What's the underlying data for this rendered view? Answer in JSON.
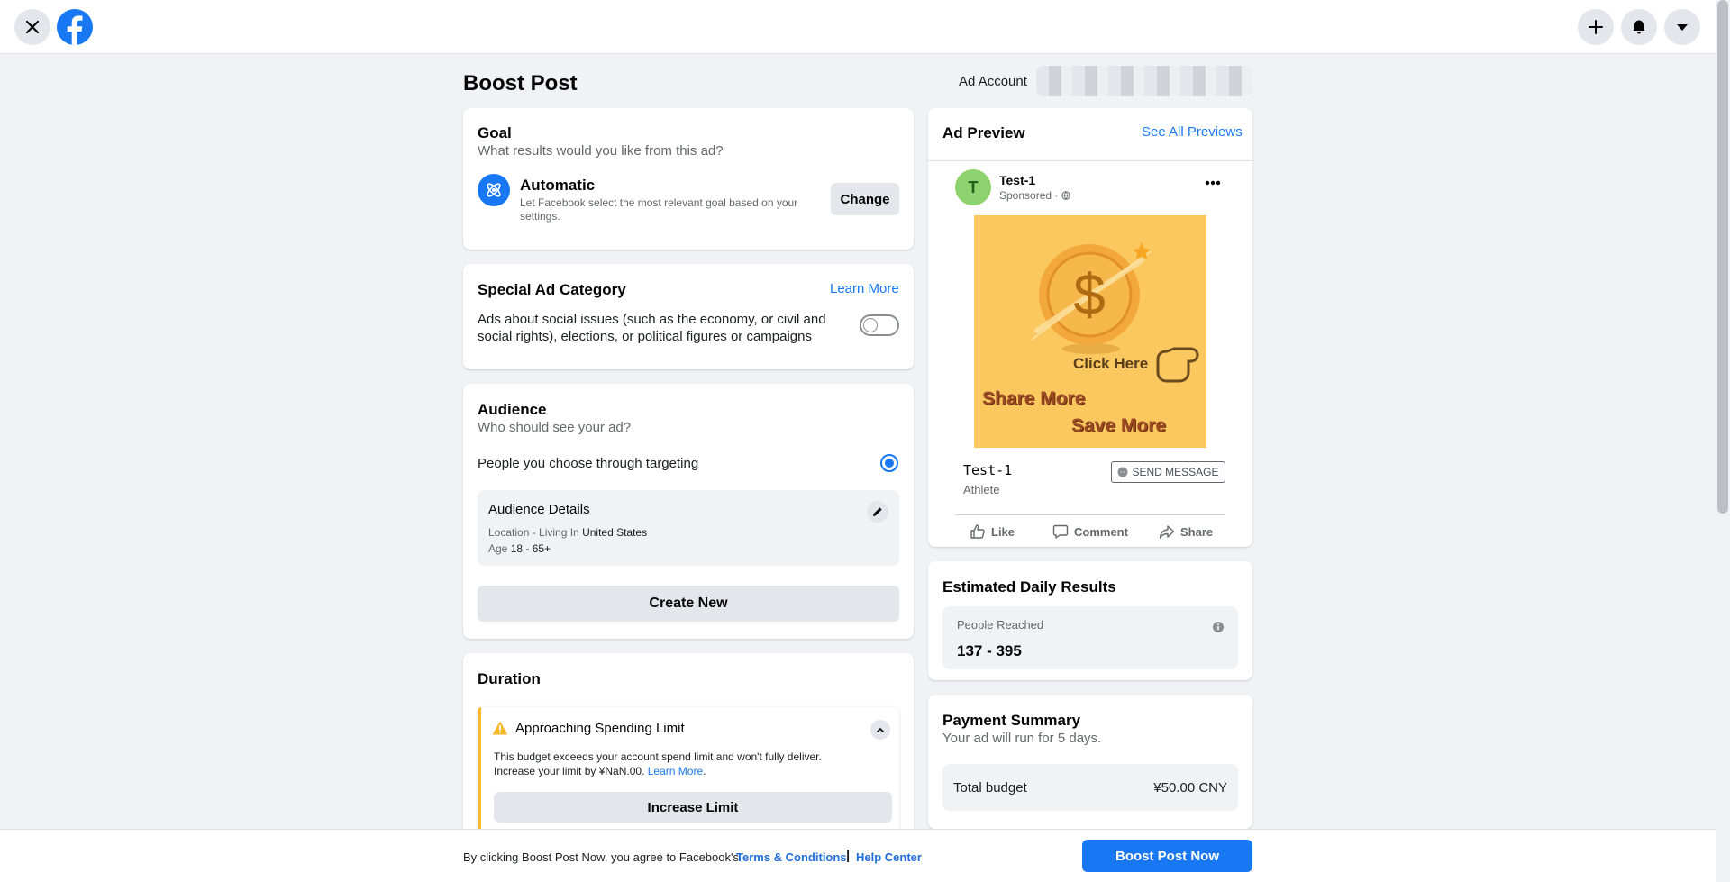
{
  "page": {
    "title": "Boost Post",
    "ad_account_label": "Ad Account"
  },
  "goal": {
    "title": "Goal",
    "subtitle": "What results would you like from this ad?",
    "option_title": "Automatic",
    "option_desc": "Let Facebook select the most relevant goal based on your settings.",
    "change_label": "Change"
  },
  "special": {
    "title": "Special Ad Category",
    "learn_more": "Learn More",
    "desc": "Ads about social issues (such as the economy, or civil and social rights), elections, or political figures or campaigns"
  },
  "audience": {
    "title": "Audience",
    "subtitle": "Who should see your ad?",
    "option": "People you choose through targeting",
    "details_title": "Audience Details",
    "location_label": "Location - Living In ",
    "location_value": "United States",
    "age_label": "Age ",
    "age_value": "18 - 65+",
    "create_new": "Create New"
  },
  "duration": {
    "title": "Duration",
    "warn_title": "Approaching Spending Limit",
    "warn_line1": "This budget exceeds your account spend limit and won't fully deliver.",
    "warn_line2": "Increase your limit by ¥NaN.00. ",
    "warn_link": "Learn More",
    "warn_period": ".",
    "increase_label": "Increase Limit"
  },
  "preview": {
    "title": "Ad Preview",
    "see_all": "See All Previews",
    "avatar_letter": "T",
    "page_name": "Test-1",
    "sponsored": "Sponsored ·",
    "img_click": "Click Here",
    "img_share": "Share More",
    "img_save": "Save More",
    "img_dollar": "$",
    "cta_title": "Test-1",
    "cta_sub": "Athlete",
    "send_message": "SEND MESSAGE",
    "like": "Like",
    "comment": "Comment",
    "share": "Share"
  },
  "estimate": {
    "title": "Estimated Daily Results",
    "reached_label": "People Reached",
    "reached_value": "137 - 395"
  },
  "payment": {
    "title": "Payment Summary",
    "subtitle": "Your ad will run for 5 days.",
    "budget_label": "Total budget",
    "budget_value": "¥50.00 CNY"
  },
  "footer": {
    "text": "By clicking Boost Post Now, you agree to Facebook's ",
    "terms": "Terms & Conditions",
    "sep": "|",
    "help": "Help Center",
    "boost_now": "Boost Post Now"
  },
  "colors": {
    "accent": "#1877f2",
    "warning": "#f7b928",
    "avatar": "#8ed16f"
  }
}
